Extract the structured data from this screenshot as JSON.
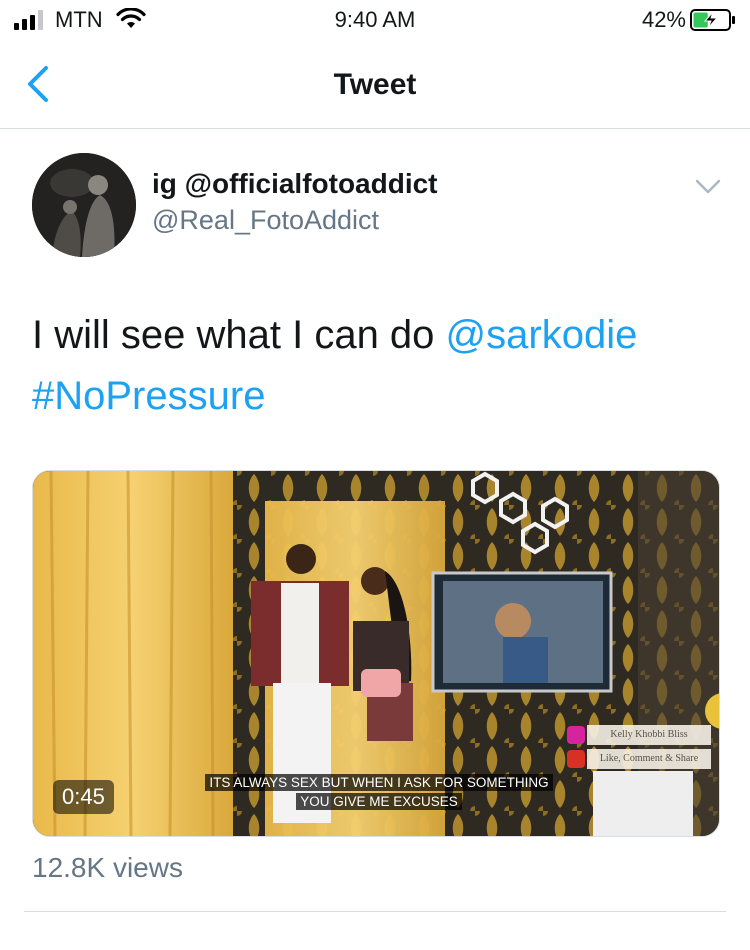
{
  "status_bar": {
    "carrier": "MTN",
    "time": "9:40 AM",
    "battery_percent": "42%",
    "battery_level": 0.42,
    "icons": [
      "signal-icon",
      "wifi-icon",
      "battery-charging-icon"
    ]
  },
  "nav": {
    "title": "Tweet",
    "back_icon": "chevron-left-icon"
  },
  "tweet": {
    "author_name": "ig @officialfotoaddict",
    "author_handle": "@Real_FotoAddict",
    "menu_icon": "chevron-down-icon",
    "text_plain": "I will see what I can do ",
    "mention": "@sarkodie",
    "hashtag": "#NoPressure",
    "video": {
      "duration": "0:45",
      "subtitle_line1": "ITS ALWAYS SEX BUT WHEN I ASK FOR SOMETHING",
      "subtitle_line2": "YOU GIVE ME EXCUSES",
      "channel_name": "Kelly Khobbi Bliss",
      "channel_cta": "Like, Comment & Share"
    },
    "views": "12.8K views"
  },
  "colors": {
    "link": "#1da1f2",
    "secondary_text": "#657786",
    "divider": "#d8dde1"
  }
}
